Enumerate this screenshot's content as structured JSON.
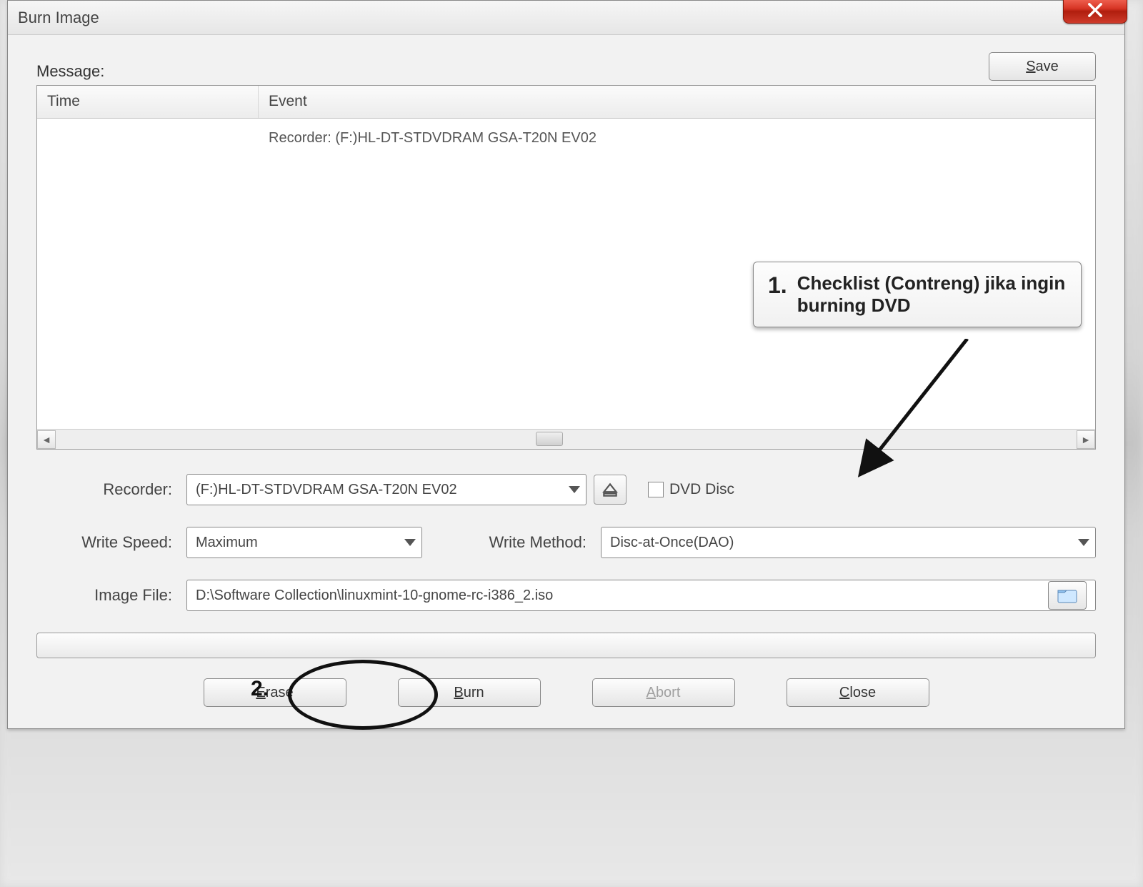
{
  "window": {
    "title": "Burn Image"
  },
  "toolbar": {
    "save_label": "Save"
  },
  "message": {
    "label": "Message:",
    "columns": {
      "time": "Time",
      "event": "Event"
    },
    "rows": [
      {
        "time": "",
        "event": "Recorder: (F:)HL-DT-STDVDRAM GSA-T20N EV02"
      }
    ]
  },
  "fields": {
    "recorder": {
      "label": "Recorder:",
      "value": "(F:)HL-DT-STDVDRAM GSA-T20N EV02"
    },
    "dvd_disc": {
      "label": "DVD Disc"
    },
    "write_speed": {
      "label": "Write Speed:",
      "value": "Maximum"
    },
    "write_method": {
      "label": "Write Method:",
      "value": "Disc-at-Once(DAO)"
    },
    "image_file": {
      "label": "Image File:",
      "value": "D:\\Software Collection\\linuxmint-10-gnome-rc-i386_2.iso"
    }
  },
  "buttons": {
    "erase": "Erase",
    "burn": "Burn",
    "abort": "Abort",
    "close": "Close"
  },
  "annotations": {
    "step1_num": "1.",
    "step1_text": "Checklist (Contreng) jika ingin burning DVD",
    "step2_num": "2."
  }
}
